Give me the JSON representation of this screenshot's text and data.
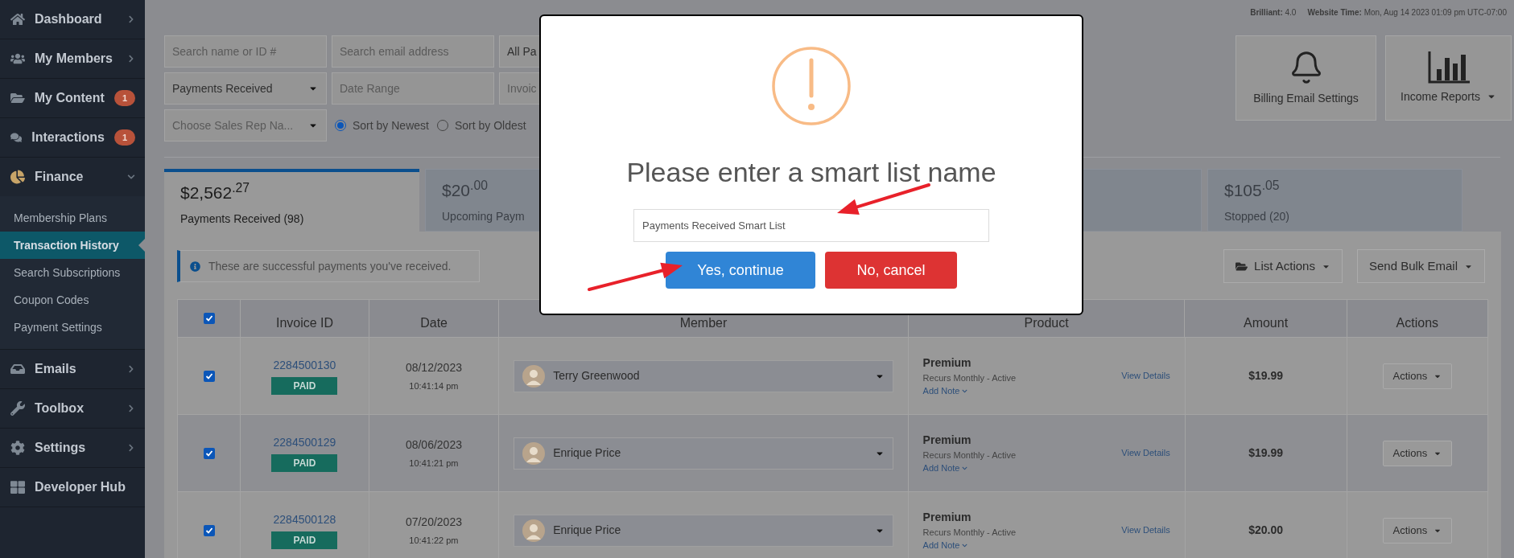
{
  "sidebar": {
    "items": [
      {
        "label": "Dashboard",
        "kind": "group",
        "expanded": false
      },
      {
        "label": "My Members",
        "kind": "group",
        "expanded": false
      },
      {
        "label": "My Content",
        "kind": "link",
        "badge": "1"
      },
      {
        "label": "Interactions",
        "kind": "link",
        "badge": "1"
      },
      {
        "label": "Finance",
        "kind": "group",
        "expanded": true,
        "children": [
          {
            "label": "Membership Plans",
            "selected": false
          },
          {
            "label": "Transaction History",
            "selected": true
          },
          {
            "label": "Search Subscriptions",
            "selected": false
          },
          {
            "label": "Coupon Codes",
            "selected": false
          },
          {
            "label": "Payment Settings",
            "selected": false
          }
        ]
      },
      {
        "label": "Emails",
        "kind": "group",
        "expanded": false
      },
      {
        "label": "Toolbox",
        "kind": "group",
        "expanded": false
      },
      {
        "label": "Settings",
        "kind": "group",
        "expanded": false
      },
      {
        "label": "Developer Hub",
        "kind": "link"
      }
    ]
  },
  "header": {
    "version": "**Brilliant:** 4.0",
    "website_time": "**Website Time:** Mon, Aug 14 2023 01:09 pm UTC-07:00"
  },
  "filters": [
    [
      {
        "kind": "input",
        "placeholder": "Search name or ID #"
      },
      {
        "kind": "input",
        "placeholder": "Search email address"
      },
      {
        "kind": "input",
        "value": "All Pa"
      }
    ],
    [
      {
        "kind": "select",
        "value": "Payments Received"
      },
      {
        "kind": "input",
        "placeholder": "Date Range"
      },
      {
        "kind": "input",
        "placeholder": "Invoic"
      }
    ],
    [
      {
        "kind": "select",
        "placeholder": "Choose Sales Rep Na..."
      },
      {
        "kind": "radio",
        "label": "Sort by Newest",
        "selected": true
      },
      {
        "kind": "radio",
        "label": "Sort by Oldest",
        "selected": false
      }
    ]
  ],
  "top_buttons": [
    {
      "label": "Billing Email Settings",
      "kind": "bell",
      "dropdown": false
    },
    {
      "label": "Income Reports",
      "kind": "chart",
      "dropdown": true
    }
  ],
  "summary_tabs": [
    {
      "amount": "$2,562$^{.27}$",
      "label": "Payments Received (98)",
      "selected": true
    },
    {
      "amount": "$20$^{.00}$",
      "label": "Upcoming Paym",
      "selected": false
    },
    {
      "selected": false
    },
    {
      "amount": "$105$^{.05}$",
      "label": "Stopped (20)",
      "selected": false
    }
  ],
  "info_alert": "These are successful payments you've received.",
  "list_buttons": [
    {
      "label": "List Actions",
      "kind": "folder"
    },
    {
      "label": "Send Bulk Email",
      "kind": "plain"
    }
  ],
  "table": {
    "select_all": {
      "checked": true
    },
    "columns": [
      "Invoice ID",
      "Date",
      "Member",
      "Product",
      "Amount",
      "Actions"
    ],
    "rows": [
      {
        "checked": true,
        "invoice_id": "2284500130",
        "status": "PAID",
        "date": "08/12/2023",
        "time": "10:41:14 pm",
        "member": "Terry Greenwood",
        "product": "Premium",
        "billing": "Recurs Monthly - Active",
        "details_link": "View Details",
        "note_link": "Add Note",
        "amount": "$19.99",
        "action": "Actions"
      },
      {
        "checked": true,
        "invoice_id": "2284500129",
        "status": "PAID",
        "date": "08/06/2023",
        "time": "10:41:21 pm",
        "member": "Enrique Price",
        "product": "Premium",
        "billing": "Recurs Monthly - Active",
        "details_link": "View Details",
        "note_link": "Add Note",
        "amount": "$19.99",
        "action": "Actions"
      },
      {
        "checked": true,
        "invoice_id": "2284500128",
        "status": "PAID",
        "date": "07/20/2023",
        "time": "10:41:22 pm",
        "member": "Enrique Price",
        "product": "Premium",
        "billing": "Recurs Monthly - Active",
        "details_link": "View Details",
        "note_link": "Add Note",
        "amount": "$20.00",
        "action": "Actions"
      }
    ]
  },
  "dialog": {
    "title": "Please enter a smart list name",
    "value": "Payments Received Smart List",
    "confirm": "Yes, continue",
    "cancel": "No, cancel"
  }
}
